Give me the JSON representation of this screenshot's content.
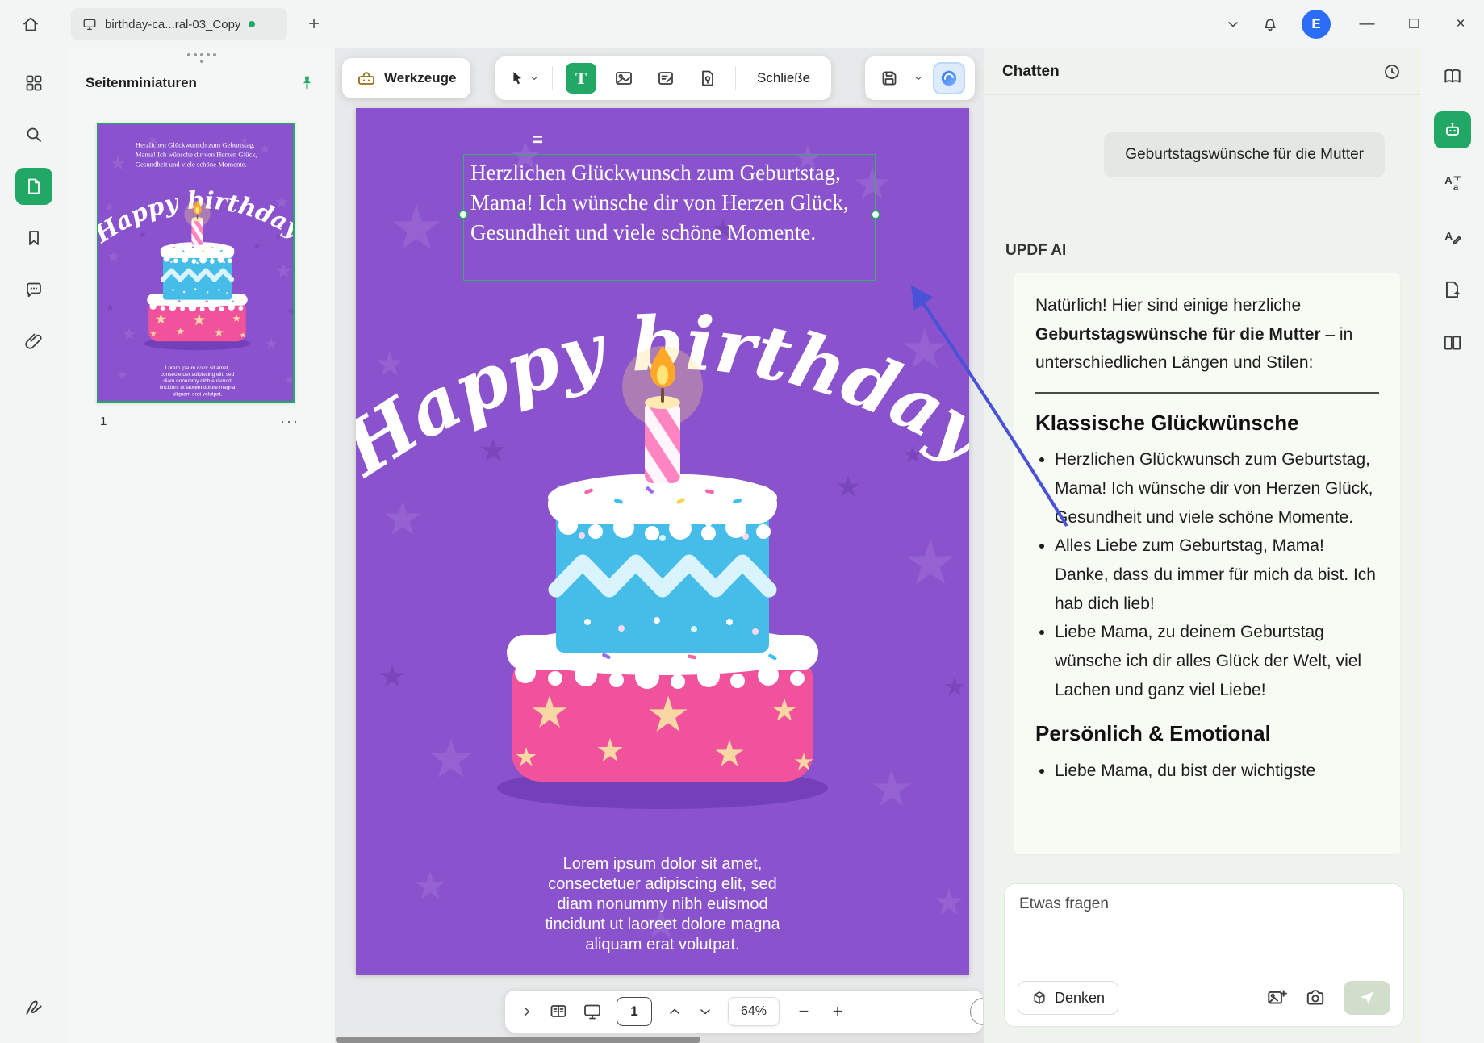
{
  "glyphs": {
    "plus": "+",
    "minus": "−",
    "close": "×",
    "minimize": "—",
    "maximize": "□",
    "ellipsis": "···",
    "drag_handle": "="
  },
  "colors": {
    "accent_green": "#21a864",
    "card_purple": "#8a52cc",
    "arrow_blue": "#4752d6"
  },
  "titlebar": {
    "tab_title": "birthday-ca...ral-03_Copy",
    "avatar_letter": "E"
  },
  "left_panel": {
    "title": "Seitenminiaturen",
    "page_number": "1"
  },
  "toolbar": {
    "werkzeuge": "Werkzeuge",
    "schliesse": "Schließe",
    "text_tool": "T"
  },
  "card": {
    "wish_text": "Herzlichen Glückwunsch zum Geburtstag, Mama! Ich wünsche dir von Herzen Glück, Gesundheit und viele schöne Momente.",
    "headline": "Happy birthday",
    "lorem": "Lorem ipsum dolor sit amet, consectetuer adipiscing elit, sed diam nonummy nibh euismod tincidunt ut laoreet dolore magna aliquam erat volutpat."
  },
  "bottom_bar": {
    "page": "1",
    "zoom": "64%"
  },
  "chat": {
    "title": "Chatten",
    "user_message": "Geburtstagswünsche für die Mutter",
    "ai_label": "UPDF AI",
    "intro_pre": "Natürlich! Hier sind einige herzliche",
    "intro_bold": "Geburtstagswünsche für die Mutter",
    "intro_post": "– in unterschiedlichen Längen und Stilen:",
    "section1_title": "Klassische Glückwünsche",
    "section1_bullets": [
      "Herzlichen Glückwunsch zum Geburtstag, Mama! Ich wünsche dir von Herzen Glück, Gesundheit und viele schöne Momente.",
      "Alles Liebe zum Geburtstag, Mama! Danke, dass du immer für mich da bist. Ich hab dich lieb!",
      "Liebe Mama, zu deinem Geburtstag wünsche ich dir alles Glück der Welt, viel Lachen und ganz viel Liebe!"
    ],
    "section2_title": "Persönlich & Emotional",
    "section2_bullets": [
      "Liebe Mama, du bist der wichtigste"
    ],
    "input_placeholder": "Etwas fragen",
    "denken": "Denken"
  }
}
